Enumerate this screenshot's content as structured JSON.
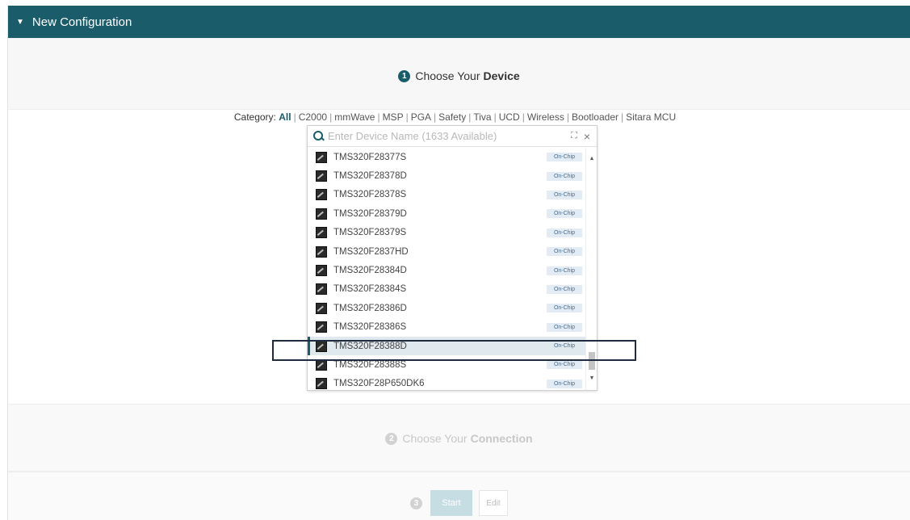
{
  "header": {
    "title": "New Configuration",
    "caret_icon": "caret-down-icon"
  },
  "step1": {
    "number": "1",
    "title_prefix": "Choose Your",
    "title_bold": "Device"
  },
  "category": {
    "label": "Category:",
    "items": [
      "All",
      "C2000",
      "mmWave",
      "MSP",
      "PGA",
      "Safety",
      "Tiva",
      "UCD",
      "Wireless",
      "Bootloader",
      "Sitara MCU"
    ],
    "active": "All"
  },
  "search": {
    "placeholder": "Enter Device Name (1633 Available)",
    "value": "",
    "expand_glyph": "⛶",
    "clear_glyph": "×"
  },
  "devices": [
    {
      "name": "TMS320F28377S",
      "badge": "On-Chip"
    },
    {
      "name": "TMS320F28378D",
      "badge": "On-Chip"
    },
    {
      "name": "TMS320F28378S",
      "badge": "On-Chip"
    },
    {
      "name": "TMS320F28379D",
      "badge": "On-Chip"
    },
    {
      "name": "TMS320F28379S",
      "badge": "On-Chip"
    },
    {
      "name": "TMS320F2837HD",
      "badge": "On-Chip"
    },
    {
      "name": "TMS320F28384D",
      "badge": "On-Chip"
    },
    {
      "name": "TMS320F28384S",
      "badge": "On-Chip"
    },
    {
      "name": "TMS320F28386D",
      "badge": "On-Chip"
    },
    {
      "name": "TMS320F28386S",
      "badge": "On-Chip"
    },
    {
      "name": "TMS320F28388D",
      "badge": "On-Chip",
      "selected": true
    },
    {
      "name": "TMS320F28388S",
      "badge": "On-Chip"
    },
    {
      "name": "TMS320F28P650DK6",
      "badge": "On-Chip"
    }
  ],
  "step2": {
    "number": "2",
    "title_prefix": "Choose Your",
    "title_bold": "Connection"
  },
  "step3": {
    "number": "3",
    "start_label": "Start",
    "edit_label": "Edit"
  },
  "colors": {
    "accent": "#1b5c6a",
    "badge_bg": "#e3ebf5",
    "highlight": "#1f2c40"
  }
}
